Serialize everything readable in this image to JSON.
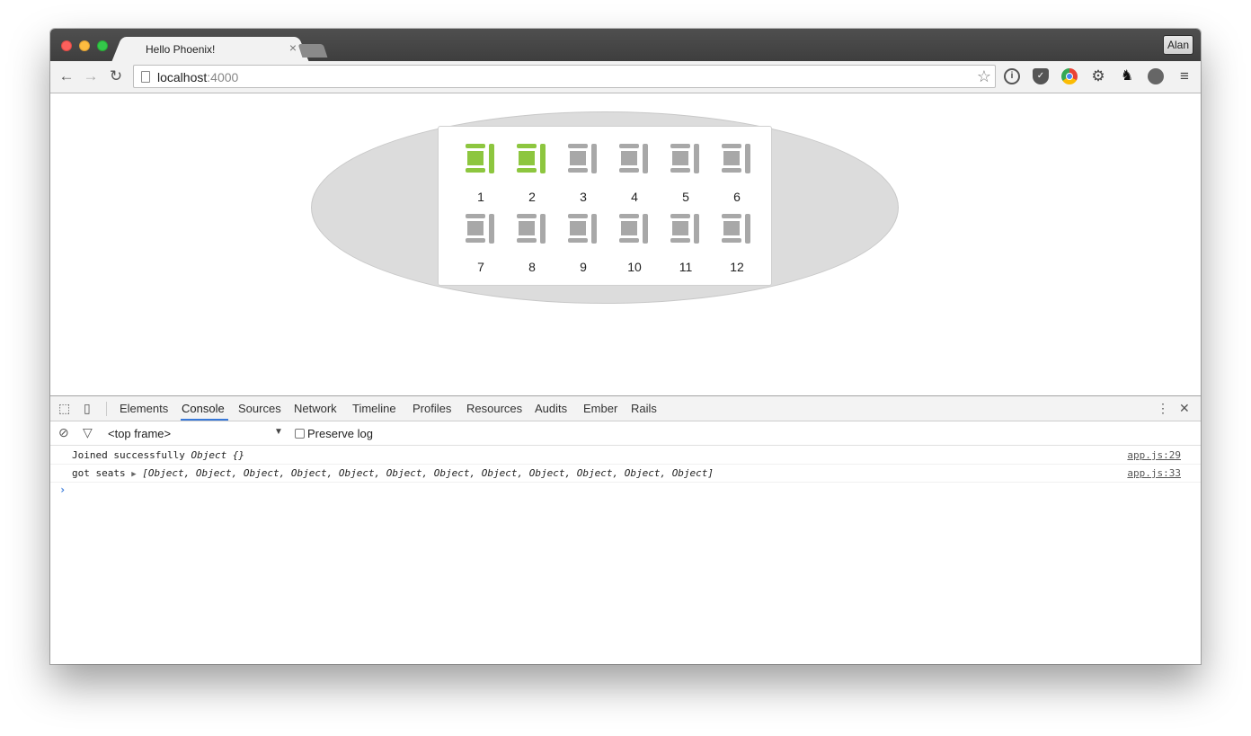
{
  "browser": {
    "tab_title": "Hello Phoenix!",
    "tab_close": "×",
    "profile": "Alan",
    "url_host": "localhost",
    "url_port": ":4000"
  },
  "page": {
    "seats": [
      {
        "number": "1",
        "taken": true
      },
      {
        "number": "2",
        "taken": true
      },
      {
        "number": "3",
        "taken": false
      },
      {
        "number": "4",
        "taken": false
      },
      {
        "number": "5",
        "taken": false
      },
      {
        "number": "6",
        "taken": false
      },
      {
        "number": "7",
        "taken": false
      },
      {
        "number": "8",
        "taken": false
      },
      {
        "number": "9",
        "taken": false
      },
      {
        "number": "10",
        "taken": false
      },
      {
        "number": "11",
        "taken": false
      },
      {
        "number": "12",
        "taken": false
      }
    ],
    "colors": {
      "taken": "#8dc63f",
      "free": "#a8a8a8"
    }
  },
  "devtools": {
    "tabs": [
      "Elements",
      "Console",
      "Sources",
      "Network",
      "Timeline",
      "Profiles",
      "Resources",
      "Audits",
      "Ember",
      "Rails"
    ],
    "active_tab": "Console",
    "frame_selector": "<top frame>",
    "preserve_log": "Preserve log",
    "logs": [
      {
        "text": "Joined successfully ",
        "obj": "Object {}",
        "source": "app.js:29"
      },
      {
        "text": "got seats ",
        "arrow": "▶",
        "obj": "[Object, Object, Object, Object, Object, Object, Object, Object, Object, Object, Object, Object]",
        "source": "app.js:33"
      }
    ],
    "prompt": "›"
  }
}
